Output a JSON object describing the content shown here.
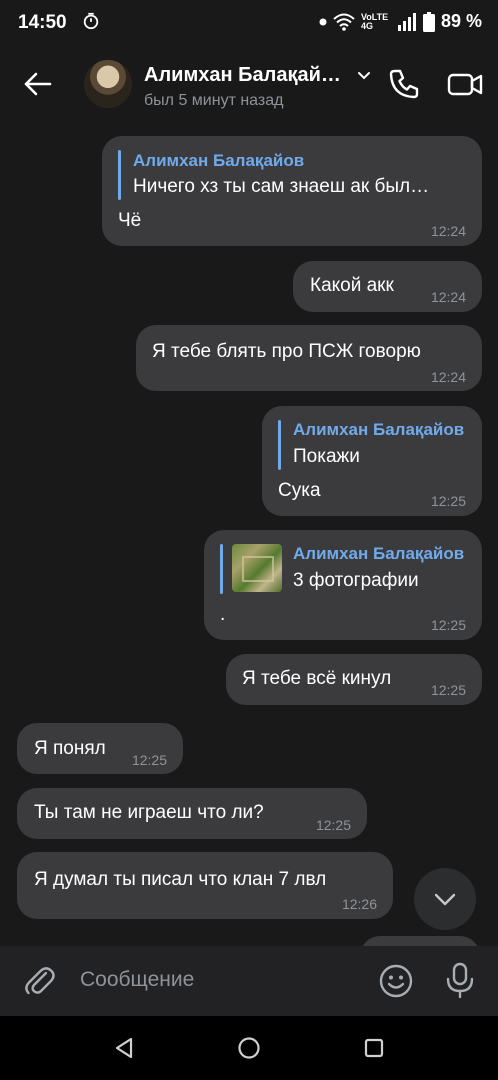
{
  "status_bar": {
    "time": "14:50",
    "network": "VoLTE 4G",
    "battery": "89 %",
    "icons": [
      "timer-icon",
      "dot-icon",
      "wifi-icon",
      "signal-icon",
      "battery-icon"
    ]
  },
  "header": {
    "contact_name": "Алимхан Балақай…",
    "last_seen": "был 5 минут назад",
    "icons": [
      "back-arrow-icon",
      "chevron-down-icon",
      "phone-icon",
      "video-camera-icon"
    ]
  },
  "messages": [
    {
      "id": "m1",
      "side": "right",
      "reply": {
        "name": "Алимхан Балақайов",
        "text": "Ничего хз ты сам знаеш ак был…"
      },
      "text": "Чё",
      "time": "12:24"
    },
    {
      "id": "m2",
      "side": "right",
      "text": "Какой акк",
      "time": "12:24"
    },
    {
      "id": "m3",
      "side": "right",
      "text": "Я тебе блять про ПСЖ говорю",
      "time": "12:24"
    },
    {
      "id": "m4",
      "side": "right",
      "reply": {
        "name": "Алимхан Балақайов",
        "text": "Покажи"
      },
      "text": "Сука",
      "time": "12:25"
    },
    {
      "id": "m5",
      "side": "right",
      "reply": {
        "name": "Алимхан Балақайов",
        "text": "3 фотографии",
        "thumbnail": "photo-thumbnail"
      },
      "text": ".",
      "time": "12:25"
    },
    {
      "id": "m6",
      "side": "right",
      "text": "Я тебе всё кинул",
      "time": "12:25"
    },
    {
      "id": "m7",
      "side": "left",
      "text": "Я понял",
      "time": "12:25"
    },
    {
      "id": "m8",
      "side": "left",
      "text": "Ты там не играеш что ли?",
      "time": "12:25"
    },
    {
      "id": "m9",
      "side": "left",
      "text": "Я думал ты писал что клан 7 лвл",
      "time": "12:26"
    }
  ],
  "composer": {
    "placeholder": "Сообщение",
    "icons": [
      "paperclip-icon",
      "emoji-icon",
      "microphone-icon"
    ]
  },
  "nav_bar": {
    "icons": [
      "back-triangle-icon",
      "home-circle-icon",
      "recents-square-icon"
    ]
  },
  "colors": {
    "background": "#19191a",
    "bubble": "#3b3b3d",
    "accent": "#71aaeb",
    "time": "#8e9399"
  }
}
